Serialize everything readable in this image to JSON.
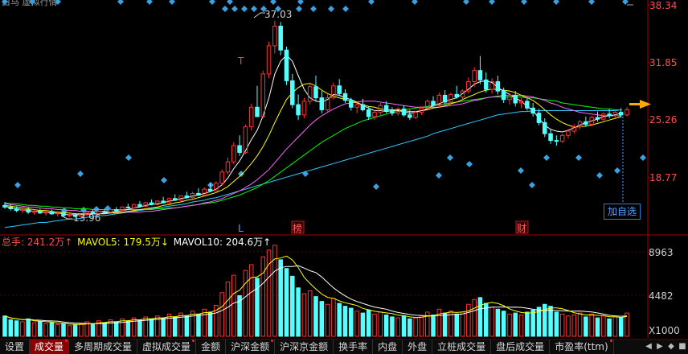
{
  "header": {
    "title": "白马 虚拟行情"
  },
  "price_axis": {
    "labels": [
      "38.34",
      "31.85",
      "25.26",
      "18.77"
    ],
    "label_color": "#ff4d4d"
  },
  "volume_axis": {
    "labels": [
      "8963",
      "4482"
    ],
    "unit": "X1000"
  },
  "annotations": {
    "high": "37.03",
    "low": "13.96",
    "event_markers": [
      {
        "text": "L",
        "color": "#4aa3ff"
      },
      {
        "text": "榜",
        "color": "#ff6060",
        "boxed": true
      },
      {
        "text": "财",
        "color": "#ff6060",
        "boxed": true
      }
    ],
    "t_marker": "T",
    "add_watch": "加自选"
  },
  "volume_legend": {
    "total": "总手: 241.2万↑",
    "mavol5": "MAVOL5: 179.5万↓",
    "mavol10": "MAVOL10: 204.6万↑"
  },
  "colors": {
    "up": "#ff3232",
    "down": "#54ffff",
    "ma5": "#ffffff",
    "ma10": "#ffff00",
    "ma20": "#ff66ff",
    "ma30": "#00ff00",
    "ma60": "#2ec8ff",
    "axis": "#aa0000",
    "arrow": "#ffaa00"
  },
  "tabs": [
    "设置",
    "成交量",
    "多周期成交量",
    "虚拟成交量",
    "金额",
    "沪深金额",
    "沪深京金额",
    "换手率",
    "内盘",
    "外盘",
    "立桩成交量",
    "盘后成交量",
    "市盈率(ttm)"
  ],
  "tab_dots": [
    0,
    1,
    0,
    1,
    0,
    1,
    0,
    0,
    0,
    0,
    0,
    0,
    1
  ],
  "active_tab": 1,
  "tab_icons": [
    "◀",
    "▶",
    "◆",
    "■"
  ],
  "chart_data": {
    "type": "candlestick",
    "price_range": [
      12.5,
      38.9
    ],
    "volume_range": [
      0,
      9800
    ],
    "volume_unit": "X1000",
    "candles": [
      [
        15.4,
        15.8,
        15.0,
        15.2,
        2100
      ],
      [
        15.2,
        15.5,
        14.8,
        15.0,
        1700
      ],
      [
        15.0,
        15.3,
        14.6,
        14.8,
        1600
      ],
      [
        14.8,
        15.1,
        14.5,
        14.9,
        1500
      ],
      [
        14.9,
        15.2,
        14.4,
        14.6,
        1800
      ],
      [
        14.6,
        14.9,
        14.3,
        14.7,
        1400
      ],
      [
        14.7,
        15.0,
        14.4,
        14.5,
        1500
      ],
      [
        14.5,
        14.8,
        14.2,
        14.6,
        1300
      ],
      [
        14.6,
        14.9,
        14.3,
        14.4,
        1400
      ],
      [
        14.4,
        14.7,
        14.1,
        14.5,
        1200
      ],
      [
        14.5,
        14.7,
        14.1,
        14.2,
        1300
      ],
      [
        14.2,
        14.5,
        14.0,
        14.3,
        1100
      ],
      [
        14.3,
        14.5,
        13.96,
        14.1,
        1200
      ],
      [
        14.1,
        14.4,
        13.96,
        14.3,
        1300
      ],
      [
        14.3,
        14.7,
        14.2,
        14.6,
        1500
      ],
      [
        14.6,
        14.9,
        14.3,
        14.4,
        1300
      ],
      [
        14.4,
        14.8,
        14.3,
        14.7,
        1600
      ],
      [
        14.7,
        15.0,
        14.5,
        14.6,
        1400
      ],
      [
        14.6,
        15.0,
        14.4,
        14.9,
        1700
      ],
      [
        14.9,
        15.2,
        14.7,
        14.8,
        1500
      ],
      [
        14.8,
        15.3,
        14.7,
        15.2,
        1800
      ],
      [
        15.2,
        15.6,
        15.0,
        15.1,
        1600
      ],
      [
        15.1,
        15.6,
        15.0,
        15.5,
        1900
      ],
      [
        15.5,
        15.9,
        15.2,
        15.3,
        1700
      ],
      [
        15.3,
        15.8,
        15.2,
        15.7,
        2000
      ],
      [
        15.7,
        16.1,
        15.4,
        15.5,
        1800
      ],
      [
        15.5,
        16.0,
        15.4,
        15.9,
        2100
      ],
      [
        15.9,
        16.4,
        15.6,
        15.7,
        1900
      ],
      [
        15.7,
        16.3,
        15.6,
        16.2,
        2300
      ],
      [
        16.2,
        16.7,
        15.9,
        16.0,
        2000
      ],
      [
        16.0,
        16.6,
        15.9,
        16.5,
        2400
      ],
      [
        16.5,
        17.0,
        16.2,
        16.3,
        2100
      ],
      [
        16.3,
        17.0,
        16.2,
        16.8,
        2600
      ],
      [
        16.8,
        17.4,
        16.5,
        16.6,
        2300
      ],
      [
        16.6,
        17.5,
        16.5,
        17.3,
        2800
      ],
      [
        17.3,
        18.0,
        17.0,
        17.1,
        2500
      ],
      [
        17.1,
        18.2,
        17.0,
        18.0,
        3200
      ],
      [
        18.0,
        19.6,
        17.8,
        19.3,
        4500
      ],
      [
        19.3,
        21.0,
        19.0,
        20.5,
        5600
      ],
      [
        20.5,
        22.8,
        20.2,
        22.4,
        6300
      ],
      [
        22.4,
        23.6,
        21.2,
        21.6,
        4200
      ],
      [
        21.6,
        24.9,
        21.4,
        24.6,
        6800
      ],
      [
        24.6,
        27.3,
        24.2,
        26.9,
        7400
      ],
      [
        26.9,
        29.4,
        26.1,
        25.8,
        6000
      ],
      [
        25.8,
        31.2,
        25.6,
        30.8,
        8200
      ],
      [
        30.8,
        34.6,
        30.3,
        34.1,
        8900
      ],
      [
        34.1,
        37.03,
        33.2,
        36.4,
        9400
      ],
      [
        36.4,
        36.9,
        33.0,
        33.6,
        7900
      ],
      [
        33.6,
        34.0,
        29.5,
        30.0,
        7000
      ],
      [
        30.0,
        30.8,
        26.8,
        27.2,
        6200
      ],
      [
        27.2,
        28.4,
        25.4,
        26.0,
        5000
      ],
      [
        26.0,
        28.0,
        25.6,
        27.6,
        4400
      ],
      [
        27.6,
        29.8,
        27.2,
        29.3,
        4700
      ],
      [
        29.3,
        30.6,
        27.6,
        28.0,
        4100
      ],
      [
        28.0,
        28.8,
        26.2,
        26.6,
        3600
      ],
      [
        26.6,
        28.4,
        26.4,
        28.0,
        3300
      ],
      [
        28.0,
        29.8,
        27.8,
        29.4,
        3900
      ],
      [
        29.4,
        30.2,
        28.2,
        28.5,
        3400
      ],
      [
        28.5,
        29.0,
        27.4,
        27.7,
        3100
      ],
      [
        27.7,
        28.0,
        26.5,
        26.9,
        2900
      ],
      [
        26.9,
        27.6,
        26.2,
        27.2,
        2600
      ],
      [
        27.2,
        27.9,
        26.4,
        26.6,
        2400
      ],
      [
        26.6,
        27.0,
        25.4,
        25.8,
        2700
      ],
      [
        25.8,
        26.6,
        25.4,
        26.3,
        2300
      ],
      [
        26.3,
        27.4,
        26.0,
        27.1,
        2500
      ],
      [
        27.1,
        27.6,
        26.2,
        26.5,
        2200
      ],
      [
        26.5,
        26.9,
        25.9,
        26.2,
        2000
      ],
      [
        26.2,
        26.9,
        25.9,
        26.7,
        1900
      ],
      [
        26.7,
        27.1,
        25.8,
        26.0,
        2100
      ],
      [
        26.0,
        26.6,
        25.4,
        25.7,
        1800
      ],
      [
        25.7,
        26.5,
        25.5,
        26.3,
        1900
      ],
      [
        26.3,
        27.0,
        26.0,
        26.8,
        2100
      ],
      [
        26.8,
        27.8,
        26.6,
        27.6,
        2500
      ],
      [
        27.6,
        28.2,
        26.8,
        27.1,
        2200
      ],
      [
        27.1,
        28.6,
        26.9,
        28.3,
        2800
      ],
      [
        28.3,
        28.9,
        27.2,
        27.5,
        2400
      ],
      [
        27.5,
        28.6,
        27.3,
        28.4,
        2600
      ],
      [
        28.4,
        29.4,
        27.9,
        28.1,
        2300
      ],
      [
        28.1,
        29.0,
        27.6,
        28.8,
        2500
      ],
      [
        28.8,
        30.4,
        28.5,
        29.9,
        3300
      ],
      [
        29.9,
        31.6,
        29.3,
        31.2,
        3800
      ],
      [
        31.2,
        32.9,
        29.6,
        30.1,
        4000
      ],
      [
        30.1,
        31.0,
        28.6,
        29.0,
        3400
      ],
      [
        29.0,
        30.3,
        28.5,
        29.9,
        3000
      ],
      [
        29.9,
        30.6,
        28.4,
        28.8,
        2800
      ],
      [
        28.8,
        29.2,
        27.4,
        27.8,
        2600
      ],
      [
        27.8,
        28.6,
        27.2,
        28.3,
        2300
      ],
      [
        28.3,
        28.8,
        27.0,
        27.4,
        2400
      ],
      [
        27.4,
        28.0,
        26.8,
        27.6,
        2200
      ],
      [
        27.6,
        28.1,
        26.5,
        26.8,
        2500
      ],
      [
        26.8,
        27.4,
        25.8,
        26.2,
        2700
      ],
      [
        26.2,
        26.7,
        24.8,
        25.1,
        3000
      ],
      [
        25.1,
        25.6,
        23.4,
        23.8,
        3300
      ],
      [
        23.8,
        24.4,
        22.6,
        23.0,
        3100
      ],
      [
        23.0,
        23.6,
        22.4,
        22.9,
        2500
      ],
      [
        22.9,
        23.8,
        22.7,
        23.6,
        2300
      ],
      [
        23.6,
        24.3,
        23.2,
        24.1,
        2100
      ],
      [
        24.1,
        24.9,
        23.8,
        24.6,
        2200
      ],
      [
        24.6,
        25.4,
        24.3,
        25.2,
        2400
      ],
      [
        25.2,
        25.8,
        24.6,
        24.9,
        2000
      ],
      [
        24.9,
        25.9,
        24.7,
        25.7,
        2300
      ],
      [
        25.7,
        26.4,
        25.2,
        25.5,
        1900
      ],
      [
        25.5,
        26.3,
        25.3,
        26.1,
        2100
      ],
      [
        26.1,
        26.7,
        25.6,
        25.9,
        1800
      ],
      [
        25.9,
        26.6,
        25.6,
        26.3,
        2000
      ],
      [
        26.3,
        26.8,
        25.7,
        26.0,
        1900
      ],
      [
        26.0,
        26.9,
        25.8,
        26.6,
        2400
      ]
    ],
    "ma5": [
      15.3,
      15.1,
      15.0,
      14.9,
      14.8,
      14.7,
      14.7,
      14.6,
      14.5,
      14.5,
      14.4,
      14.3,
      14.3,
      14.3,
      14.3,
      14.4,
      14.4,
      14.5,
      14.6,
      14.7,
      14.8,
      14.9,
      15.1,
      15.2,
      15.4,
      15.5,
      15.6,
      15.7,
      15.9,
      16.0,
      16.2,
      16.3,
      16.5,
      16.6,
      16.8,
      17.0,
      17.3,
      17.8,
      18.6,
      19.7,
      20.6,
      21.8,
      23.1,
      24.2,
      25.9,
      28.0,
      30.8,
      32.3,
      33.0,
      32.3,
      30.6,
      29.0,
      28.0,
      27.6,
      27.5,
      27.8,
      28.4,
      28.3,
      28.0,
      27.8,
      27.5,
      27.1,
      26.8,
      26.5,
      26.5,
      26.4,
      26.5,
      26.5,
      26.4,
      26.2,
      26.3,
      26.5,
      26.7,
      27.1,
      27.3,
      27.6,
      27.8,
      28.0,
      28.5,
      29.0,
      29.6,
      29.9,
      30.0,
      29.8,
      29.2,
      28.8,
      28.4,
      28.0,
      27.6,
      27.0,
      26.5,
      25.6,
      24.8,
      24.3,
      24.1,
      24.0,
      24.2,
      24.5,
      24.8,
      25.1,
      25.3,
      25.5,
      25.8,
      25.9,
      26.0,
      26.2
    ],
    "ma10": [
      15.4,
      15.3,
      15.2,
      15.1,
      15.0,
      14.9,
      14.8,
      14.8,
      14.7,
      14.6,
      14.6,
      14.5,
      14.4,
      14.4,
      14.4,
      14.4,
      14.4,
      14.4,
      14.5,
      14.5,
      14.6,
      14.7,
      14.8,
      14.9,
      15.0,
      15.1,
      15.2,
      15.4,
      15.5,
      15.7,
      15.8,
      16.0,
      16.1,
      16.3,
      16.5,
      16.7,
      16.9,
      17.2,
      17.6,
      18.2,
      18.8,
      19.5,
      20.3,
      21.2,
      22.3,
      23.6,
      25.1,
      26.5,
      27.8,
      28.6,
      29.2,
      29.6,
      29.7,
      29.4,
      28.9,
      28.5,
      28.2,
      28.0,
      27.8,
      27.6,
      27.4,
      27.2,
      27.0,
      26.9,
      26.7,
      26.6,
      26.6,
      26.6,
      26.5,
      26.4,
      26.4,
      26.5,
      26.6,
      26.8,
      26.9,
      27.1,
      27.3,
      27.5,
      27.8,
      28.1,
      28.4,
      28.7,
      28.9,
      29.0,
      29.0,
      28.9,
      28.8,
      28.6,
      28.3,
      28.0,
      27.7,
      27.2,
      26.6,
      26.0,
      25.5,
      25.1,
      24.8,
      24.6,
      24.6,
      24.7,
      24.8,
      25.0,
      25.2,
      25.4,
      25.6,
      25.8
    ],
    "ma20": [
      15.6,
      15.5,
      15.4,
      15.3,
      15.2,
      15.2,
      15.1,
      15.0,
      15.0,
      14.9,
      14.9,
      14.8,
      14.8,
      14.7,
      14.7,
      14.7,
      14.7,
      14.7,
      14.6,
      14.6,
      14.6,
      14.6,
      14.6,
      14.6,
      14.7,
      14.7,
      14.8,
      14.9,
      15.0,
      15.1,
      15.2,
      15.3,
      15.4,
      15.5,
      15.7,
      15.8,
      16.0,
      16.2,
      16.5,
      16.8,
      17.1,
      17.5,
      17.9,
      18.4,
      19.0,
      19.6,
      20.4,
      21.2,
      22.0,
      22.7,
      23.4,
      24.1,
      24.8,
      25.4,
      25.9,
      26.3,
      26.7,
      27.0,
      27.3,
      27.4,
      27.5,
      27.6,
      27.6,
      27.6,
      27.5,
      27.4,
      27.3,
      27.2,
      27.1,
      27.0,
      26.9,
      26.9,
      26.9,
      26.9,
      26.9,
      27.0,
      27.1,
      27.2,
      27.3,
      27.5,
      27.7,
      27.8,
      28.0,
      28.1,
      28.2,
      28.3,
      28.3,
      28.3,
      28.3,
      28.2,
      28.1,
      27.9,
      27.7,
      27.4,
      27.2,
      26.9,
      26.7,
      26.5,
      26.3,
      26.2,
      26.1,
      26.0,
      25.9,
      25.9,
      25.9,
      25.9
    ],
    "ma30": [
      15.7,
      15.6,
      15.6,
      15.5,
      15.4,
      15.4,
      15.3,
      15.3,
      15.2,
      15.2,
      15.1,
      15.1,
      15.0,
      15.0,
      15.0,
      14.9,
      14.9,
      14.9,
      14.9,
      14.9,
      14.9,
      14.9,
      14.9,
      14.9,
      14.9,
      14.9,
      15.0,
      15.0,
      15.1,
      15.1,
      15.2,
      15.3,
      15.4,
      15.5,
      15.6,
      15.7,
      15.8,
      16.0,
      16.2,
      16.4,
      16.6,
      16.9,
      17.2,
      17.5,
      17.9,
      18.3,
      18.8,
      19.3,
      19.8,
      20.3,
      20.8,
      21.3,
      21.8,
      22.3,
      22.8,
      23.2,
      23.6,
      24.0,
      24.4,
      24.7,
      25.0,
      25.3,
      25.5,
      25.7,
      25.9,
      26.1,
      26.3,
      26.4,
      26.6,
      26.7,
      26.8,
      26.9,
      27.0,
      27.1,
      27.2,
      27.3,
      27.4,
      27.5,
      27.6,
      27.7,
      27.8,
      27.9,
      28.0,
      28.1,
      28.1,
      28.1,
      28.1,
      28.1,
      28.1,
      28.0,
      28.0,
      27.9,
      27.8,
      27.7,
      27.6,
      27.4,
      27.3,
      27.2,
      27.1,
      27.0,
      26.9,
      26.8,
      26.7,
      26.7,
      26.6,
      26.6
    ],
    "ma60": [
      12.8,
      12.9,
      13.0,
      13.1,
      13.2,
      13.3,
      13.4,
      13.4,
      13.5,
      13.6,
      13.7,
      13.8,
      13.8,
      13.9,
      14.0,
      14.1,
      14.2,
      14.2,
      14.3,
      14.4,
      14.5,
      14.6,
      14.7,
      14.8,
      14.9,
      15.0,
      15.1,
      15.2,
      15.3,
      15.4,
      15.5,
      15.6,
      15.8,
      15.9,
      16.0,
      16.2,
      16.3,
      16.5,
      16.7,
      16.9,
      17.1,
      17.3,
      17.5,
      17.7,
      17.9,
      18.1,
      18.3,
      18.5,
      18.7,
      18.9,
      19.1,
      19.3,
      19.5,
      19.7,
      19.9,
      20.1,
      20.3,
      20.5,
      20.7,
      20.9,
      21.1,
      21.3,
      21.5,
      21.7,
      21.9,
      22.1,
      22.3,
      22.5,
      22.7,
      22.9,
      23.1,
      23.3,
      23.5,
      23.8,
      24.0,
      24.2,
      24.4,
      24.6,
      24.8,
      25.0,
      25.2,
      25.4,
      25.6,
      25.8,
      26.0,
      26.1,
      26.2,
      26.3,
      26.4,
      26.4,
      26.5,
      26.5,
      26.5,
      26.5,
      26.5,
      26.5,
      26.5,
      26.5,
      26.5,
      26.5,
      26.5,
      26.5,
      26.5,
      26.5,
      26.5,
      26.6
    ]
  }
}
